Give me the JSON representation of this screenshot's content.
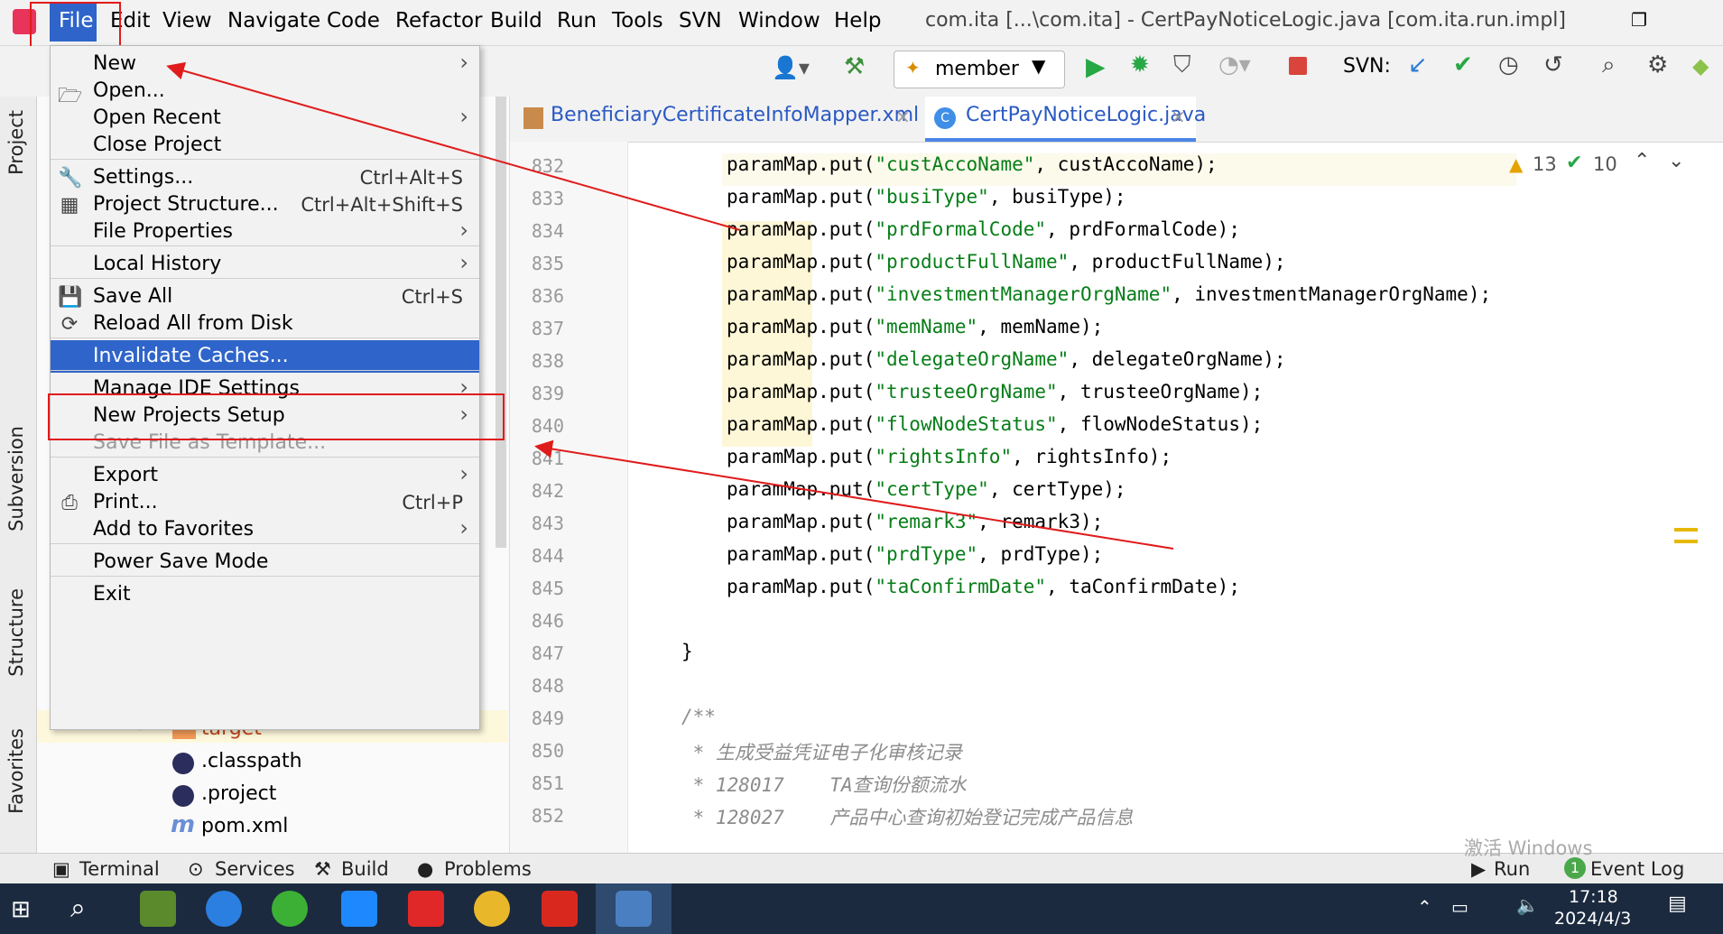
{
  "menubar": {
    "items": [
      "File",
      "Edit",
      "View",
      "Navigate",
      "Code",
      "Refactor",
      "Build",
      "Run",
      "Tools",
      "SVN",
      "Window",
      "Help"
    ],
    "window_title": "com.ita [...\\com.ita] - CertPayNoticeLogic.java [com.ita.run.impl]"
  },
  "toolbar": {
    "run_config": "member",
    "svn_label": "SVN:"
  },
  "left_tabs": [
    "Project",
    "Subversion",
    "Structure",
    "Favorites"
  ],
  "file_menu": {
    "items": [
      {
        "label": "New",
        "shortcut": "",
        "submenu": true,
        "icon": ""
      },
      {
        "label": "Open...",
        "shortcut": "",
        "submenu": false,
        "icon": "folder-icon"
      },
      {
        "label": "Open Recent",
        "shortcut": "",
        "submenu": true,
        "icon": ""
      },
      {
        "label": "Close Project",
        "shortcut": "",
        "submenu": false,
        "icon": ""
      },
      {
        "label": "Settings...",
        "shortcut": "Ctrl+Alt+S",
        "submenu": false,
        "icon": "wrench-icon"
      },
      {
        "label": "Project Structure...",
        "shortcut": "Ctrl+Alt+Shift+S",
        "submenu": false,
        "icon": "project-structure-icon"
      },
      {
        "label": "File Properties",
        "shortcut": "",
        "submenu": true,
        "icon": ""
      },
      {
        "label": "Local History",
        "shortcut": "",
        "submenu": true,
        "icon": ""
      },
      {
        "label": "Save All",
        "shortcut": "Ctrl+S",
        "submenu": false,
        "icon": "save-icon"
      },
      {
        "label": "Reload All from Disk",
        "shortcut": "",
        "submenu": false,
        "icon": "reload-icon"
      },
      {
        "label": "Invalidate Caches...",
        "shortcut": "",
        "submenu": false,
        "icon": ""
      },
      {
        "label": "Manage IDE Settings",
        "shortcut": "",
        "submenu": true,
        "icon": ""
      },
      {
        "label": "New Projects Setup",
        "shortcut": "",
        "submenu": true,
        "icon": ""
      },
      {
        "label": "Save File as Template...",
        "shortcut": "",
        "submenu": false,
        "icon": ""
      },
      {
        "label": "Export",
        "shortcut": "",
        "submenu": true,
        "icon": ""
      },
      {
        "label": "Print...",
        "shortcut": "Ctrl+P",
        "submenu": false,
        "icon": "print-icon"
      },
      {
        "label": "Add to Favorites",
        "shortcut": "",
        "submenu": true,
        "icon": ""
      },
      {
        "label": "Power Save Mode",
        "shortcut": "",
        "submenu": false,
        "icon": ""
      },
      {
        "label": "Exit",
        "shortcut": "",
        "submenu": false,
        "icon": ""
      }
    ]
  },
  "project_tree": [
    {
      "label": "target"
    },
    {
      "label": ".classpath"
    },
    {
      "label": ".project"
    },
    {
      "label": "pom.xml"
    }
  ],
  "editor": {
    "tabs": [
      "BeneficiaryCertificateInfoMapper.xml",
      "CertPayNoticeLogic.java"
    ],
    "warnings": "13",
    "checks": "10",
    "lines": [
      {
        "n": "832",
        "key": "custAccoName",
        "var": "custAccoName"
      },
      {
        "n": "833",
        "key": "busiType",
        "var": "busiType"
      },
      {
        "n": "834",
        "key": "prdFormalCode",
        "var": "prdFormalCode"
      },
      {
        "n": "835",
        "key": "productFullName",
        "var": "productFullName"
      },
      {
        "n": "836",
        "key": "investmentManagerOrgName",
        "var": "investmentManagerOrgName"
      },
      {
        "n": "837",
        "key": "memName",
        "var": "memName"
      },
      {
        "n": "838",
        "key": "delegateOrgName",
        "var": "delegateOrgName"
      },
      {
        "n": "839",
        "key": "trusteeOrgName",
        "var": "trusteeOrgName"
      },
      {
        "n": "840",
        "key": "flowNodeStatus",
        "var": "flowNodeStatus"
      },
      {
        "n": "841",
        "key": "rightsInfo",
        "var": "rightsInfo"
      },
      {
        "n": "842",
        "key": "certType",
        "var": "certType"
      },
      {
        "n": "843",
        "key": "remark3",
        "var": "remark3"
      },
      {
        "n": "844",
        "key": "prdType",
        "var": "prdType"
      },
      {
        "n": "845",
        "key": "taConfirmDate",
        "var": "taConfirmDate"
      }
    ],
    "tail_lines": [
      {
        "n": "846",
        "text": ""
      },
      {
        "n": "847",
        "text": "}"
      },
      {
        "n": "848",
        "text": ""
      },
      {
        "n": "849",
        "text": "/**"
      },
      {
        "n": "850",
        "text": " * 生成受益凭证电子化审核记录"
      },
      {
        "n": "851",
        "text": " * 128017    TA查询份额流水"
      },
      {
        "n": "852",
        "text": " * 128027    产品中心查询初始登记完成产品信息"
      }
    ]
  },
  "bottom_bar": {
    "left": [
      "Terminal",
      "Services",
      "Build",
      "Problems"
    ],
    "right": [
      "Run",
      "Event Log"
    ],
    "event_count": "1",
    "watermark": "激活 Windows"
  },
  "taskbar": {
    "time": "17:18",
    "date": "2024/4/3"
  }
}
